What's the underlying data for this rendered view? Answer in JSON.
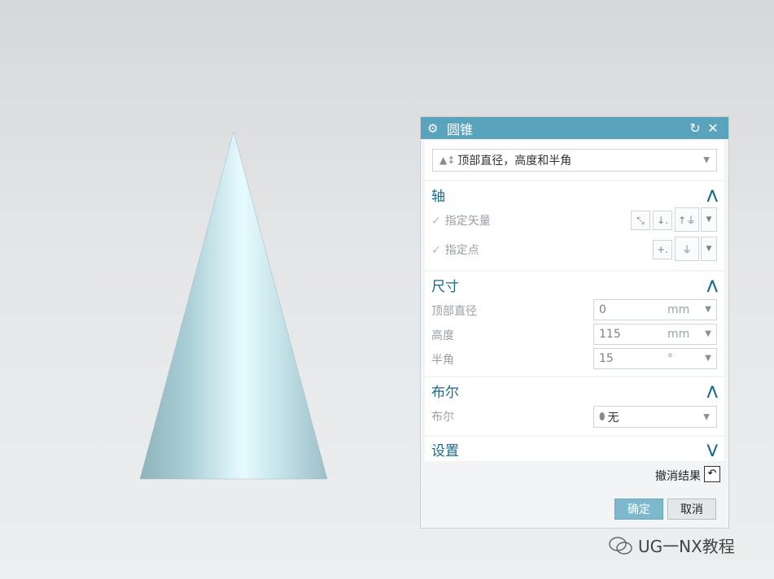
{
  "dialog": {
    "title": "圆锥",
    "icons": {
      "settings": "gear-icon",
      "reset": "reset-icon",
      "close": "close-icon"
    },
    "type_select": {
      "value": "顶部直径，高度和半角"
    },
    "axis": {
      "header": "轴",
      "vector_label": "指定矢量",
      "point_label": "指定点"
    },
    "dimensions": {
      "header": "尺寸",
      "fields": [
        {
          "label": "顶部直径",
          "value": "0",
          "unit": "mm"
        },
        {
          "label": "高度",
          "value": "115",
          "unit": "mm"
        },
        {
          "label": "半角",
          "value": "15",
          "unit": "°"
        }
      ]
    },
    "boolean": {
      "header": "布尔",
      "label": "布尔",
      "value": "无"
    },
    "settings": {
      "header": "设置"
    },
    "undo_label": "撤消结果",
    "ok_label": "确定",
    "cancel_label": "取消"
  },
  "watermark": {
    "text": "UG一NX教程"
  },
  "colors": {
    "titlebar": "#5aa3bd",
    "section_header": "#1a6a8f",
    "ok_button": "#7eb8cc",
    "cone": "#b8d9e0"
  }
}
